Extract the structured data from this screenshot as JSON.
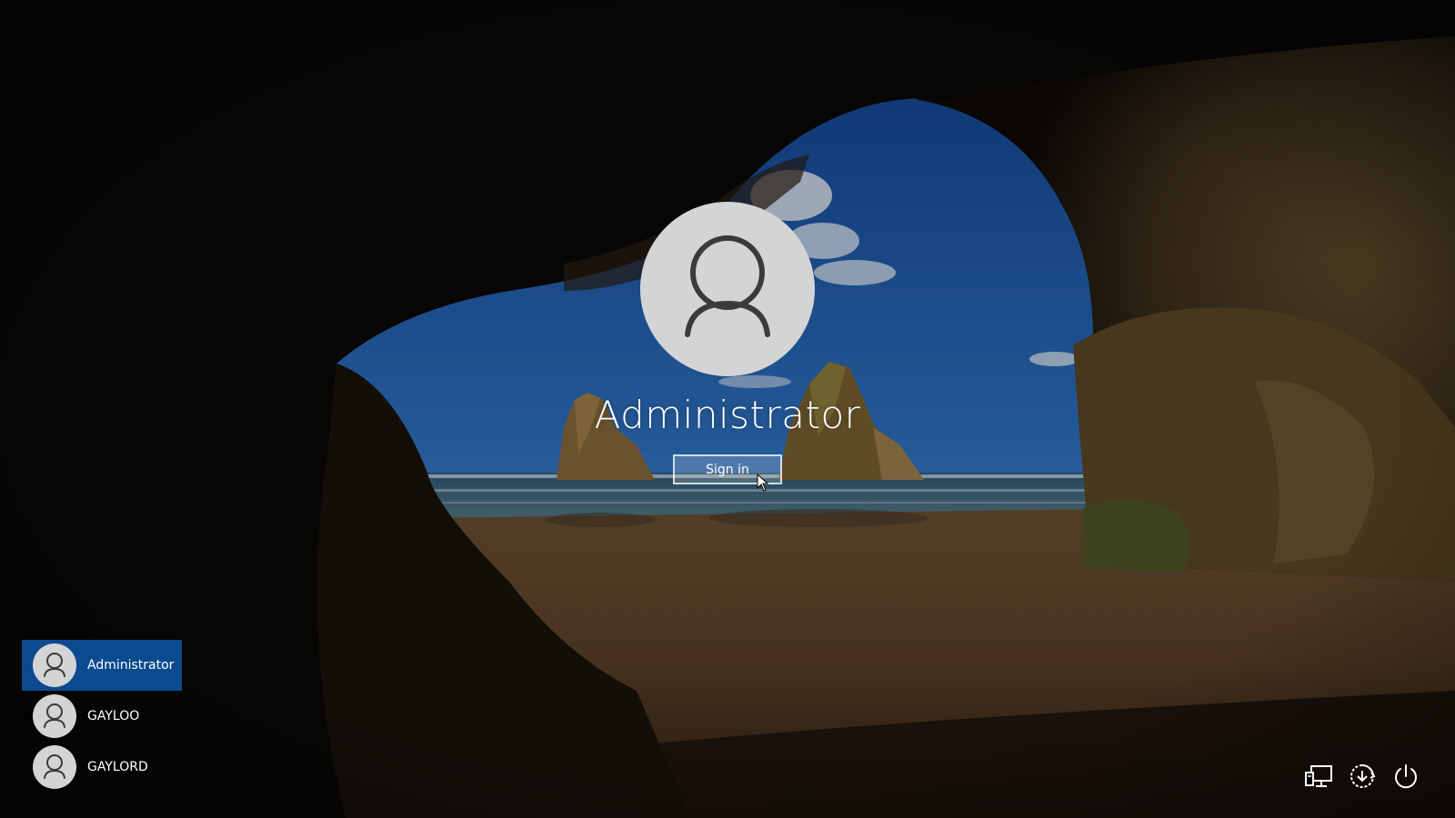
{
  "login": {
    "selected_user": "Administrator",
    "sign_in_label": "Sign in"
  },
  "users": [
    {
      "name": "Administrator",
      "selected": true
    },
    {
      "name": "GAYLOO",
      "selected": false
    },
    {
      "name": "GAYLORD",
      "selected": false
    }
  ],
  "tray_icons": [
    "network-icon",
    "ease-of-access-icon",
    "power-icon"
  ],
  "colors": {
    "selected_user_bg": "#0b4a8f",
    "avatar_bg": "#d3d4d5",
    "text": "#ffffff"
  }
}
